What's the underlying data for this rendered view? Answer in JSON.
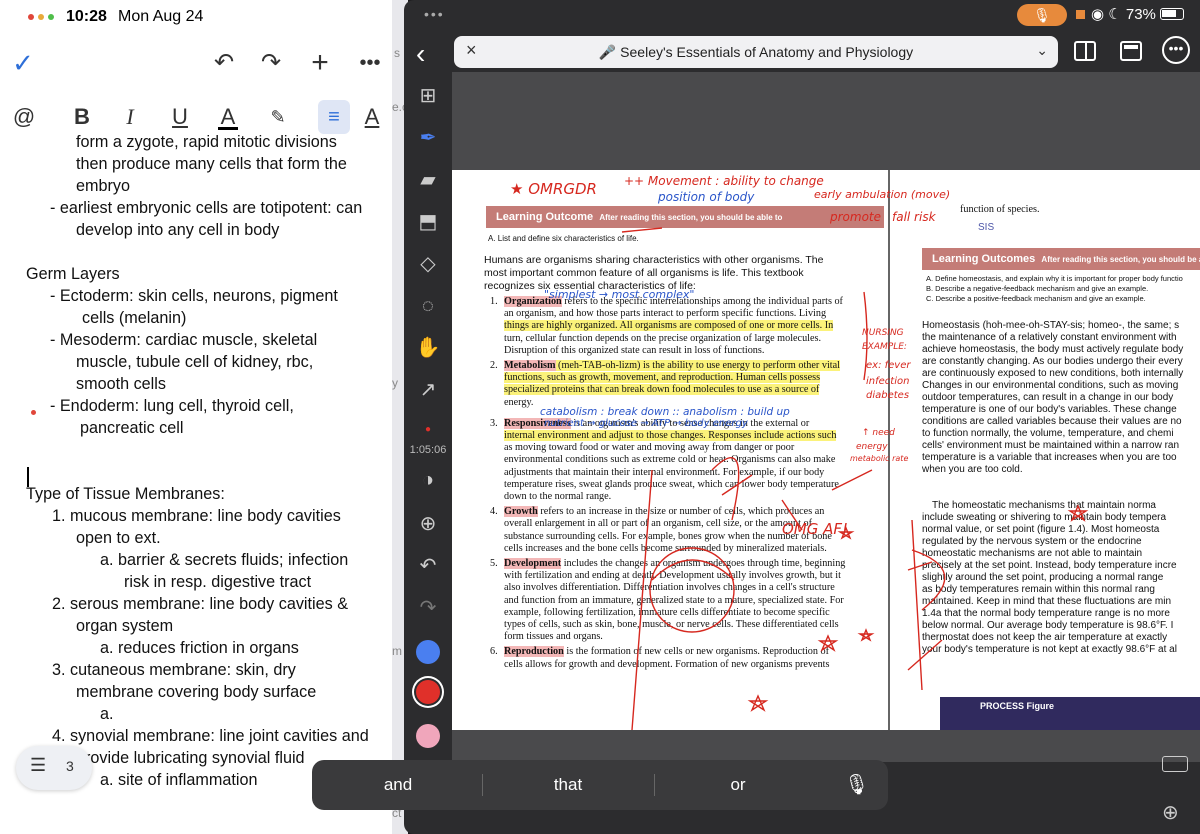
{
  "notes": {
    "status": {
      "time": "10:28",
      "date": "Mon Aug 24"
    },
    "toolbar": {
      "done": "✓",
      "undo": "↶",
      "redo": "↷",
      "add": "+",
      "more": "•••"
    },
    "format": {
      "at": "@",
      "bold": "B",
      "italic": "I",
      "underline": "U",
      "text_color": "A",
      "highlight": "✎",
      "align": "≡",
      "text_style": "A"
    },
    "lines": [
      "form a zygote, rapid mitotic divisions",
      "then produce many cells that form the",
      "embryo",
      "- earliest embryonic cells are totipotent: can",
      "develop into any cell in body",
      "Germ Layers",
      "- Ectoderm: skin cells, neurons, pigment",
      "cells (melanin)",
      "- Mesoderm: cardiac muscle, skeletal",
      "muscle, tubule cell of kidney, rbc,",
      "smooth cells",
      "- Endoderm: lung cell, thyroid cell,",
      "pancreatic cell",
      "Type of Tissue Membranes:",
      "1.  mucous membrane: line body cavities",
      "open to ext.",
      "a.  barrier & secrets fluids; infection",
      "risk in resp. digestive tract",
      "2.  serous membrane: line body cavities &",
      "organ system",
      "a.  reduces friction in organs",
      "3.  cutaneous membrane: skin, dry",
      "membrane covering body surface",
      "a.",
      "4.  synovial membrane: line joint cavities and",
      "provide lubricating synovial fluid",
      "a.  site of inflammation"
    ],
    "page_pill": {
      "icon": "☰",
      "count": "3"
    }
  },
  "strip": {
    "frags": [
      "s",
      "e.c",
      "y",
      "m",
      "ct"
    ]
  },
  "pdf": {
    "status": {
      "battery": "73%"
    },
    "title": "🎤 Seeley's Essentials of Anatomy and Physiology",
    "timer": "1:05:06",
    "colors": {
      "blue": "#4a7ff0",
      "red": "#e0302a",
      "pink": "#f0a6bb"
    },
    "left_page": {
      "lo_title": "Learning Outcome",
      "lo_sub": "After reading this section, you should be able to",
      "lo_item": "A.  List and define six characteristics of life.",
      "intro": [
        "Humans are organisms sharing characteristics with other organisms. The",
        "most important common feature of all organisms is life. This textbook",
        "recognizes six essential characteristics of life:"
      ],
      "items": [
        [
          "1.",
          "Organization",
          " refers to the specific interrelationships among the individual parts of"
        ],
        [
          "",
          "",
          "an organism, and how those parts interact to perform specific functions. Living"
        ],
        [
          "",
          "",
          "things are highly organized. All organisms are composed of one or more cells. In"
        ],
        [
          "",
          "",
          "turn, cellular function depends on the precise organization of large molecules."
        ],
        [
          "",
          "",
          "Disruption of this organized state can result in loss of functions."
        ],
        [
          "2.",
          "Metabolism",
          " (meh-TAB-oh-lizm) is the ability to use energy to perform other vital"
        ],
        [
          "",
          "",
          "functions, such as growth, movement, and reproduction. Human cells possess"
        ],
        [
          "",
          "",
          "specialized proteins that can break down food molecules to use as a source of"
        ],
        [
          "",
          "",
          "energy."
        ],
        [
          "3.",
          "Responsiveness",
          " is an organism's ability to sense changes in the external or"
        ],
        [
          "",
          "",
          "internal environment and adjust to those changes. Responses include actions such"
        ],
        [
          "",
          "",
          "as moving toward food or water and moving away from danger or poor"
        ],
        [
          "",
          "",
          "environmental conditions such as extreme cold or heat. Organisms can also make"
        ],
        [
          "",
          "",
          "adjustments that maintain their internal environment. For example, if our body"
        ],
        [
          "",
          "",
          "temperature rises, sweat glands produce sweat, which can lower body temperature"
        ],
        [
          "",
          "",
          "down to the normal range."
        ],
        [
          "4.",
          "Growth",
          " refers to an increase in the size or number of cells, which produces an"
        ],
        [
          "",
          "",
          "overall enlargement in all or part of an organism, cell size, or the amount of"
        ],
        [
          "",
          "",
          "substance surrounding cells. For example, bones grow when the number of bone"
        ],
        [
          "",
          "",
          "cells increases and the bone cells become surrounded by mineralized materials."
        ],
        [
          "5.",
          "Development",
          " includes the changes an organism undergoes through time, beginning"
        ],
        [
          "",
          "",
          "with fertilization and ending at death. Development usually involves growth, but it"
        ],
        [
          "",
          "",
          "also involves differentiation. Differentiation involves changes in a cell's structure"
        ],
        [
          "",
          "",
          "and function from an immature, generalized state to a mature, specialized state. For"
        ],
        [
          "",
          "",
          "example, following fertilization, immature cells differentiate to become specific"
        ],
        [
          "",
          "",
          "types of cells, such as skin, bone, muscle, or nerve cells. These differentiated cells"
        ],
        [
          "",
          "",
          "form tissues and organs."
        ],
        [
          "6.",
          "Reproduction",
          " is the formation of new cells or new organisms. Reproduction of"
        ],
        [
          "",
          "",
          "cells allows for growth and development. Formation of new organisms prevents"
        ]
      ]
    },
    "right_page": {
      "top_frag": "function of species.",
      "top_frag2": "SIS",
      "lo_title": "Learning Outcomes",
      "lo_sub": "After reading this section, you should be able to",
      "lo_items": [
        "A.  Define homeostasis, and explain why it is important for proper body functio",
        "B.  Describe a negative-feedback mechanism and give an example.",
        "C.  Describe a positive-feedback mechanism and give an example."
      ],
      "para1": [
        "Homeostasis (hoh-mee-oh-STAY-sis; homeo-, the same; s",
        "the maintenance of a relatively constant environment with",
        "achieve homeostasis, the body must actively regulate body",
        "are constantly changing. As our bodies undergo their every",
        "are continuously exposed to new conditions, both internally",
        "Changes in our environmental conditions, such as moving",
        "outdoor temperatures, can result in a change in our body",
        "temperature is one of our body's variables. These change",
        "conditions are called variables because their values are no",
        "to function normally, the volume, temperature, and chemi",
        "cells' environment must be maintained within a narrow ran",
        "temperature is a variable that increases when you are too",
        "when you are too cold."
      ],
      "para2": [
        "The homeostatic mechanisms that maintain norma",
        "include sweating or shivering to maintain body tempera",
        "normal value, or set point (figure 1.4). Most homeosta",
        "regulated by the nervous system or the endocrine",
        "homeostatic mechanisms are not able to maintain",
        "precisely at the set point. Instead, body temperature incre",
        "slightly around the set point, producing a normal range",
        "as body temperatures remain within this normal rang",
        "maintained. Keep in mind that these fluctuations are min",
        "1.4a that the normal body temperature range is no more",
        "below normal. Our average body temperature is 98.6°F. I",
        "thermostat does not keep the air temperature at exactly",
        "your body's temperature is not kept at exactly 98.6°F at al"
      ],
      "process_fig": "PROCESS Figure"
    },
    "annotations": {
      "omrgdr": "★ OMRGDR",
      "movement": "++ Movement : ability to change",
      "movement2": "position of body",
      "ambulation": "early ambulation (move)",
      "promote": "promote",
      "fall": "fall risk",
      "simplest": "\"simplest → most complex\"",
      "nursing": "NURSING",
      "example": "EXAMPLE:",
      "fever": "ex: fever",
      "infection": "infection",
      "diabetes": "diabetes",
      "catabolism": "catabolism : break down  :: anabolism : build up",
      "nutrient": "nutrient → glucose → ATP → body energy",
      "need": "↑ need",
      "energy": "energy",
      "meta": "metabolic rate",
      "exclaim": "OMG AF!"
    }
  },
  "keyboard": {
    "s1": "and",
    "s2": "that",
    "s3": "or",
    "mic": "🎙"
  }
}
